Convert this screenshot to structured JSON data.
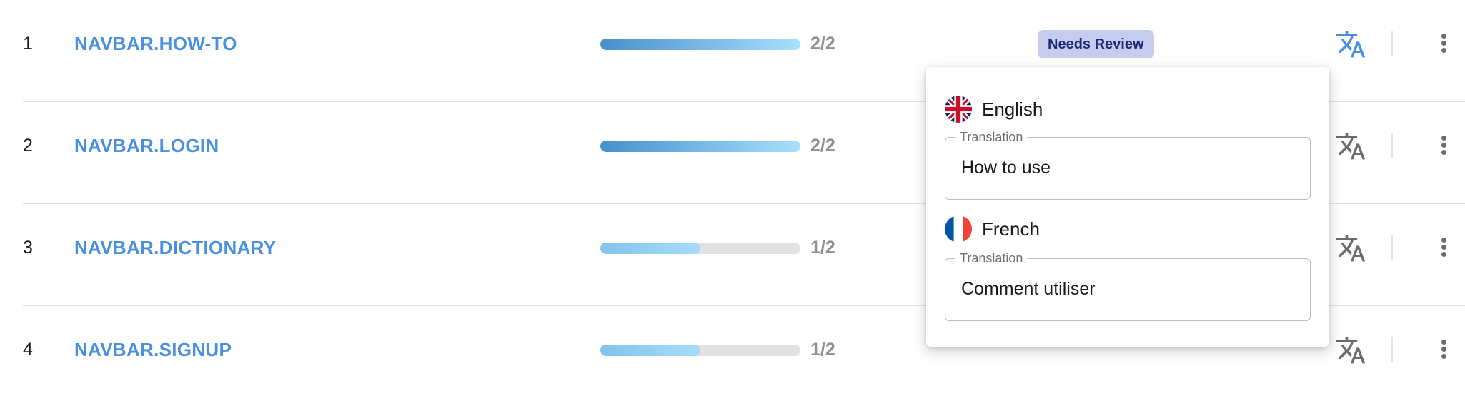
{
  "rows": [
    {
      "index": "1",
      "key": "NAVBAR.HOW-TO",
      "progress": 1.0,
      "count": "2/2",
      "status": "Needs Review"
    },
    {
      "index": "2",
      "key": "NAVBAR.LOGIN",
      "progress": 1.0,
      "count": "2/2",
      "status": ""
    },
    {
      "index": "3",
      "key": "NAVBAR.DICTIONARY",
      "progress": 0.5,
      "count": "1/2",
      "status": ""
    },
    {
      "index": "4",
      "key": "NAVBAR.SIGNUP",
      "progress": 0.5,
      "count": "1/2",
      "status": ""
    }
  ],
  "icons": {
    "translate": "translate-icon",
    "more": "more-vertical-icon",
    "flag_en": "uk-flag-icon",
    "flag_fr": "france-flag-icon"
  },
  "colors": {
    "key_link": "#4a90e2",
    "translate_active": "#4a90e2",
    "translate_inactive": "#6b6b6b",
    "badge_bg": "#c7cbed",
    "badge_text": "#1e2a78"
  },
  "popover": {
    "languages": [
      {
        "name": "English",
        "field_label": "Translation",
        "value": "How to use"
      },
      {
        "name": "French",
        "field_label": "Translation",
        "value": "Comment utiliser"
      }
    ]
  }
}
